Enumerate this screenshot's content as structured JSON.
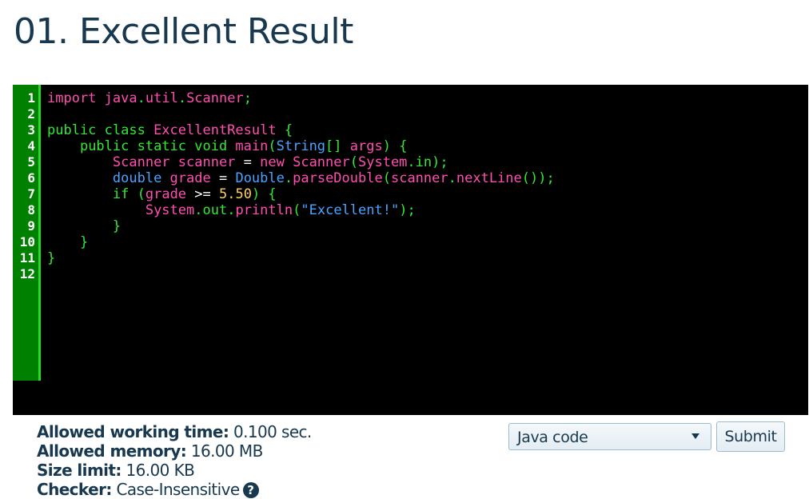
{
  "page": {
    "title": "01. Excellent Result"
  },
  "editor": {
    "line_numbers": [
      "1",
      "2",
      "3",
      "4",
      "5",
      "6",
      "7",
      "8",
      "9",
      "10",
      "11",
      "12"
    ],
    "lines": [
      [
        {
          "t": "kw",
          "v": "import "
        },
        {
          "t": "id",
          "v": "java"
        },
        {
          "t": "punct",
          "v": "."
        },
        {
          "t": "id",
          "v": "util"
        },
        {
          "t": "punct",
          "v": "."
        },
        {
          "t": "id",
          "v": "Scanner"
        },
        {
          "t": "punct",
          "v": ";"
        }
      ],
      [],
      [
        {
          "t": "kwg",
          "v": "public class "
        },
        {
          "t": "id",
          "v": "ExcellentResult "
        },
        {
          "t": "punct",
          "v": "{"
        }
      ],
      [
        {
          "t": "plain",
          "v": "    "
        },
        {
          "t": "kwg",
          "v": "public static void "
        },
        {
          "t": "fn",
          "v": "main"
        },
        {
          "t": "punct",
          "v": "("
        },
        {
          "t": "type",
          "v": "String"
        },
        {
          "t": "punct",
          "v": "[] "
        },
        {
          "t": "id",
          "v": "args"
        },
        {
          "t": "punct",
          "v": ") {"
        }
      ],
      [
        {
          "t": "plain",
          "v": "        "
        },
        {
          "t": "id",
          "v": "Scanner scanner "
        },
        {
          "t": "op",
          "v": "= "
        },
        {
          "t": "kw",
          "v": "new "
        },
        {
          "t": "id",
          "v": "Scanner"
        },
        {
          "t": "punct",
          "v": "("
        },
        {
          "t": "id",
          "v": "System"
        },
        {
          "t": "punct",
          "v": "."
        },
        {
          "t": "kwg",
          "v": "in"
        },
        {
          "t": "punct",
          "v": ");"
        }
      ],
      [
        {
          "t": "plain",
          "v": "        "
        },
        {
          "t": "type",
          "v": "double "
        },
        {
          "t": "id",
          "v": "grade "
        },
        {
          "t": "op",
          "v": "= "
        },
        {
          "t": "type",
          "v": "Double"
        },
        {
          "t": "punct",
          "v": "."
        },
        {
          "t": "fn",
          "v": "parseDouble"
        },
        {
          "t": "punct",
          "v": "("
        },
        {
          "t": "id",
          "v": "scanner"
        },
        {
          "t": "punct",
          "v": "."
        },
        {
          "t": "fn",
          "v": "nextLine"
        },
        {
          "t": "punct",
          "v": "());"
        }
      ],
      [
        {
          "t": "plain",
          "v": "        "
        },
        {
          "t": "kwg",
          "v": "if "
        },
        {
          "t": "punct",
          "v": "("
        },
        {
          "t": "id",
          "v": "grade "
        },
        {
          "t": "op",
          "v": ">= "
        },
        {
          "t": "num",
          "v": "5.50"
        },
        {
          "t": "punct",
          "v": ") {"
        }
      ],
      [
        {
          "t": "plain",
          "v": "            "
        },
        {
          "t": "id",
          "v": "System"
        },
        {
          "t": "punct",
          "v": "."
        },
        {
          "t": "kwg",
          "v": "out"
        },
        {
          "t": "punct",
          "v": "."
        },
        {
          "t": "fn",
          "v": "println"
        },
        {
          "t": "punct",
          "v": "("
        },
        {
          "t": "str",
          "v": "\"Excellent!\""
        },
        {
          "t": "punct",
          "v": ");"
        }
      ],
      [
        {
          "t": "plain",
          "v": "        "
        },
        {
          "t": "punct",
          "v": "}"
        }
      ],
      [
        {
          "t": "plain",
          "v": "    "
        },
        {
          "t": "punct",
          "v": "}"
        }
      ],
      [
        {
          "t": "punct",
          "v": "}"
        }
      ],
      []
    ]
  },
  "limits": {
    "time_label": "Allowed working time:",
    "time_value": " 0.100 sec.",
    "memory_label": "Allowed memory:",
    "memory_value": " 16.00 MB",
    "size_label": "Size limit:",
    "size_value": " 16.00 KB",
    "checker_label": "Checker:",
    "checker_value": " Case-Insensitive",
    "help_glyph": "?"
  },
  "submission": {
    "language_selected": "Java code",
    "submit_label": "Submit"
  }
}
